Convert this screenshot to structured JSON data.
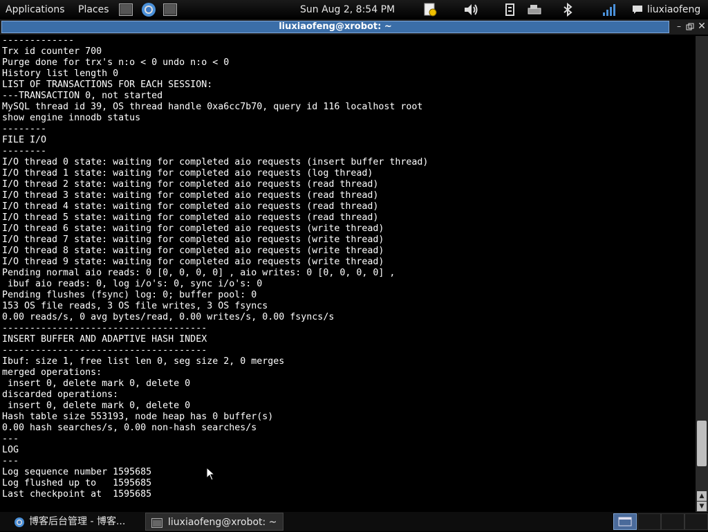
{
  "top_panel": {
    "applications": "Applications",
    "places": "Places",
    "clock": "Sun Aug  2,  8:54 PM",
    "user": "liuxiaofeng",
    "launchers": [
      "terminal-icon",
      "chrome-icon",
      "terminal-icon"
    ],
    "tray_icons": [
      "update-icon",
      "volume-icon",
      "keyboard-icon",
      "network-icon",
      "bluetooth-icon",
      "signal-icon",
      "chat-icon"
    ]
  },
  "window": {
    "title": "liuxiaofeng@xrobot: ~"
  },
  "terminal": {
    "lines": [
      "-------------",
      "Trx id counter 700",
      "Purge done for trx's n:o < 0 undo n:o < 0",
      "History list length 0",
      "LIST OF TRANSACTIONS FOR EACH SESSION:",
      "---TRANSACTION 0, not started",
      "MySQL thread id 39, OS thread handle 0xa6cc7b70, query id 116 localhost root",
      "show engine innodb status",
      "--------",
      "FILE I/O",
      "--------",
      "I/O thread 0 state: waiting for completed aio requests (insert buffer thread)",
      "I/O thread 1 state: waiting for completed aio requests (log thread)",
      "I/O thread 2 state: waiting for completed aio requests (read thread)",
      "I/O thread 3 state: waiting for completed aio requests (read thread)",
      "I/O thread 4 state: waiting for completed aio requests (read thread)",
      "I/O thread 5 state: waiting for completed aio requests (read thread)",
      "I/O thread 6 state: waiting for completed aio requests (write thread)",
      "I/O thread 7 state: waiting for completed aio requests (write thread)",
      "I/O thread 8 state: waiting for completed aio requests (write thread)",
      "I/O thread 9 state: waiting for completed aio requests (write thread)",
      "Pending normal aio reads: 0 [0, 0, 0, 0] , aio writes: 0 [0, 0, 0, 0] ,",
      " ibuf aio reads: 0, log i/o's: 0, sync i/o's: 0",
      "Pending flushes (fsync) log: 0; buffer pool: 0",
      "153 OS file reads, 3 OS file writes, 3 OS fsyncs",
      "0.00 reads/s, 0 avg bytes/read, 0.00 writes/s, 0.00 fsyncs/s",
      "-------------------------------------",
      "INSERT BUFFER AND ADAPTIVE HASH INDEX",
      "-------------------------------------",
      "Ibuf: size 1, free list len 0, seg size 2, 0 merges",
      "merged operations:",
      " insert 0, delete mark 0, delete 0",
      "discarded operations:",
      " insert 0, delete mark 0, delete 0",
      "Hash table size 553193, node heap has 0 buffer(s)",
      "0.00 hash searches/s, 0.00 non-hash searches/s",
      "---",
      "LOG",
      "---",
      "Log sequence number 1595685",
      "Log flushed up to   1595685",
      "Last checkpoint at  1595685"
    ]
  },
  "taskbar": {
    "tasks": [
      {
        "label": "博客后台管理 - 博客...",
        "icon": "chrome-icon"
      },
      {
        "label": "liuxiaofeng@xrobot: ~",
        "icon": "terminal-icon"
      }
    ]
  }
}
